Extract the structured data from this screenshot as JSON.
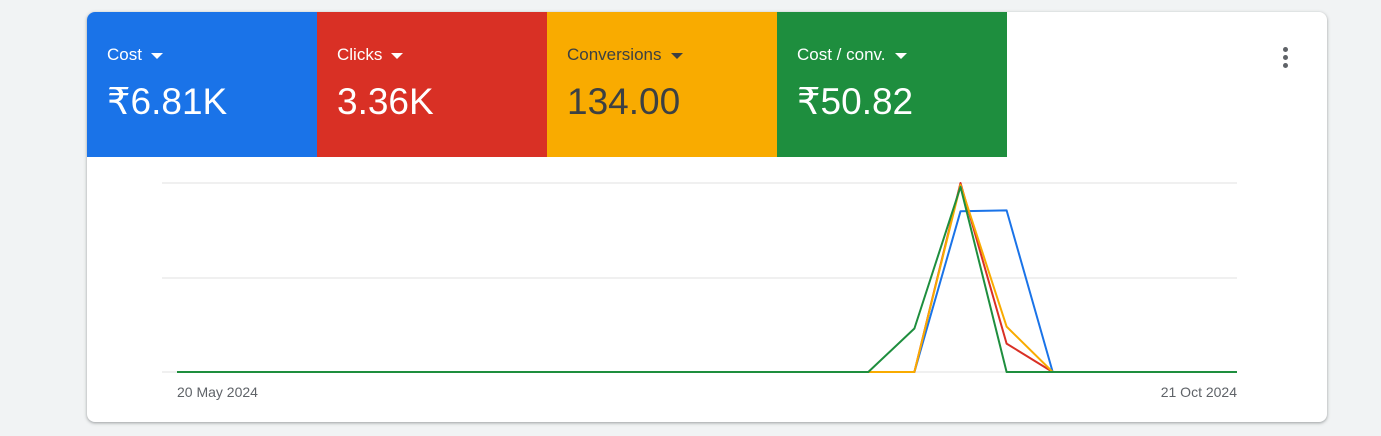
{
  "metrics": [
    {
      "label": "Cost",
      "value": "₹6.81K",
      "bg": "#1a73e8",
      "fg": "#ffffff"
    },
    {
      "label": "Clicks",
      "value": "3.36K",
      "bg": "#d93025",
      "fg": "#ffffff"
    },
    {
      "label": "Conversions",
      "value": "134.00",
      "bg": "#f9ab00",
      "fg": "#3c4043"
    },
    {
      "label": "Cost / conv.",
      "value": "₹50.82",
      "bg": "#1e8e3e",
      "fg": "#ffffff"
    }
  ],
  "more_menu_icon": "more-vert-icon",
  "chart_data": {
    "type": "line",
    "x_start_label": "20 May 2024",
    "x_end_label": "21 Oct 2024",
    "grid": true,
    "normalized": true,
    "ylim": [
      0,
      1
    ],
    "x_count": 24,
    "series": [
      {
        "color": "#1a73e8",
        "values": [
          0,
          0,
          0,
          0,
          0,
          0,
          0,
          0,
          0,
          0,
          0,
          0,
          0,
          0,
          0,
          0,
          0,
          0.85,
          0.855,
          0,
          0,
          0,
          0,
          0
        ]
      },
      {
        "color": "#d93025",
        "values": [
          0,
          0,
          0,
          0,
          0,
          0,
          0,
          0,
          0,
          0,
          0,
          0,
          0,
          0,
          0,
          0,
          0,
          1.0,
          0.15,
          0,
          0,
          0,
          0,
          0
        ]
      },
      {
        "color": "#f9ab00",
        "values": [
          0,
          0,
          0,
          0,
          0,
          0,
          0,
          0,
          0,
          0,
          0,
          0,
          0,
          0,
          0,
          0,
          0,
          0.99,
          0.24,
          0,
          0,
          0,
          0,
          0
        ]
      },
      {
        "color": "#1e8e3e",
        "values": [
          0,
          0,
          0,
          0,
          0,
          0,
          0,
          0,
          0,
          0,
          0,
          0,
          0,
          0,
          0,
          0,
          0.23,
          0.98,
          0,
          0,
          0,
          0,
          0,
          0
        ]
      }
    ]
  }
}
